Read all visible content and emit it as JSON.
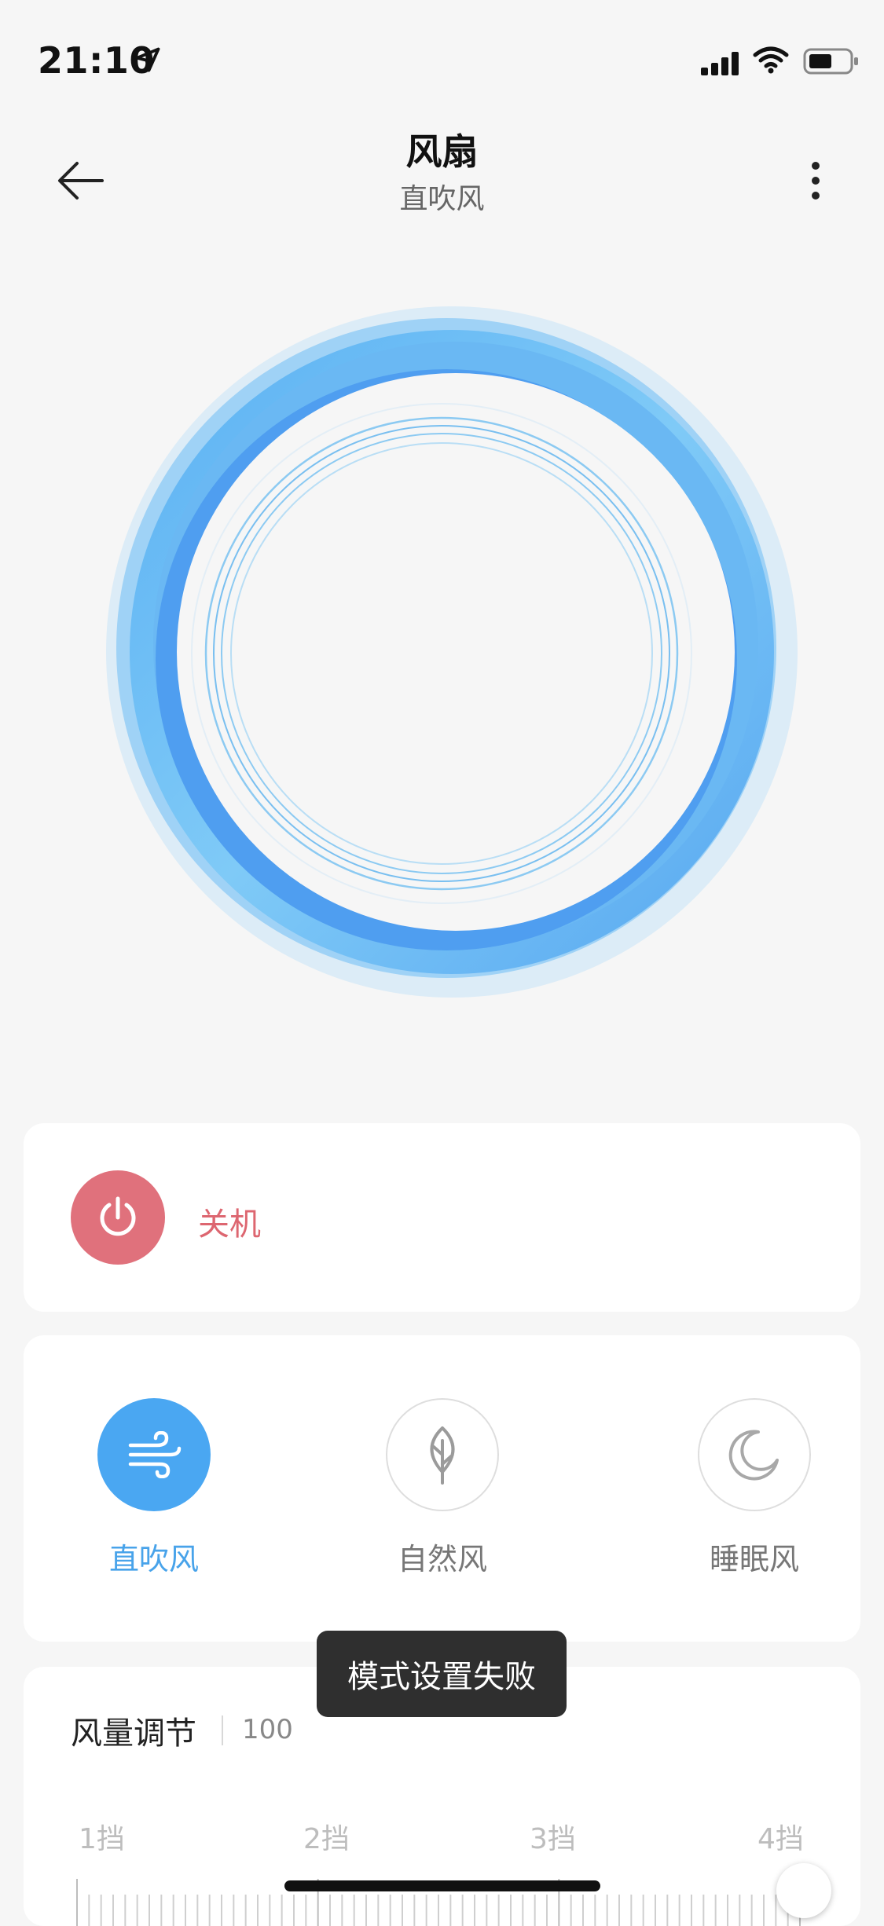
{
  "status_bar": {
    "time": "21:10"
  },
  "header": {
    "title": "风扇",
    "subtitle": "直吹风"
  },
  "power": {
    "label": "关机",
    "color": "#e0717c"
  },
  "modes": [
    {
      "label": "直吹风",
      "icon": "wind-icon",
      "active": true
    },
    {
      "label": "自然风",
      "icon": "leaf-icon",
      "active": false
    },
    {
      "label": "睡眠风",
      "icon": "moon-icon",
      "active": false
    }
  ],
  "wind": {
    "title": "风量调节",
    "value": "100",
    "gears": [
      "1挡",
      "2挡",
      "3挡",
      "4挡"
    ],
    "level_fraction": 1.0
  },
  "toast": {
    "text": "模式设置失败"
  },
  "colors": {
    "accent": "#4aa7f2",
    "danger": "#e0717c"
  }
}
